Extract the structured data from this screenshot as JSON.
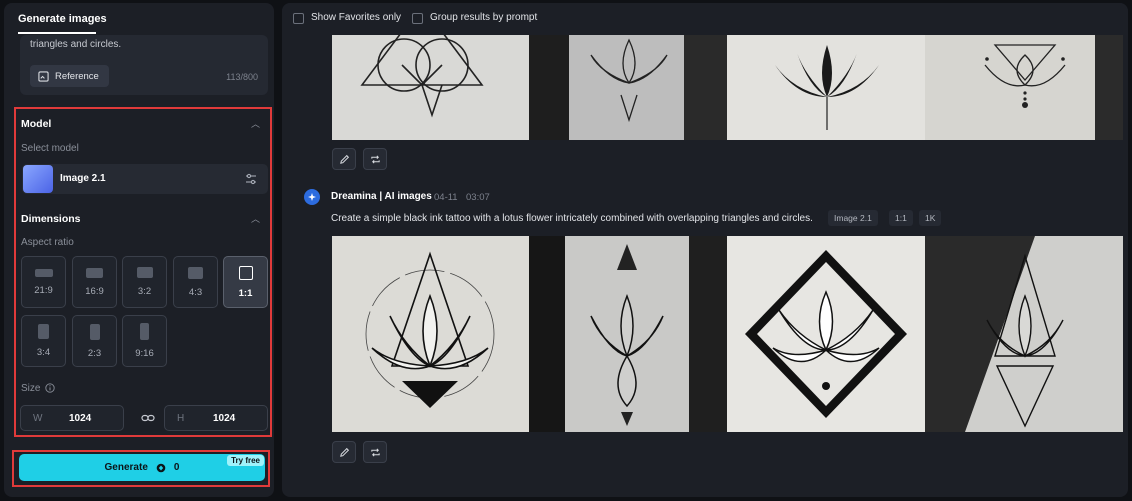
{
  "left_panel": {
    "tab_label": "Generate images",
    "prompt_snippet": "triangles and circles.",
    "reference_label": "Reference",
    "char_count": "113/800",
    "model": {
      "section_title": "Model",
      "select_label": "Select model",
      "selected_model": "Image 2.1"
    },
    "dimensions": {
      "section_title": "Dimensions",
      "aspect_label": "Aspect ratio",
      "ratios": [
        "21:9",
        "16:9",
        "3:2",
        "4:3",
        "1:1",
        "3:4",
        "2:3",
        "9:16"
      ],
      "selected_ratio": "1:1",
      "size_label": "Size",
      "width_label": "W",
      "width_value": "1024",
      "height_label": "H",
      "height_value": "1024"
    },
    "generate": {
      "label": "Generate",
      "cost": "0",
      "badge": "Try free"
    }
  },
  "top_bar": {
    "show_favorites": "Show Favorites only",
    "group_results": "Group results by prompt"
  },
  "results": {
    "author": "Dreamina | AI images",
    "date": "04-11",
    "time": "03:07",
    "prompt": "Create a simple black ink tattoo with a lotus flower intricately combined with overlapping triangles and circles.",
    "tags": [
      "Image 2.1",
      "1:1",
      "1K"
    ]
  },
  "colors": {
    "accent": "#1fcfe6",
    "highlight_border": "#e03a3a",
    "panel_bg": "#1c1f26",
    "page_bg": "#0f1115"
  }
}
